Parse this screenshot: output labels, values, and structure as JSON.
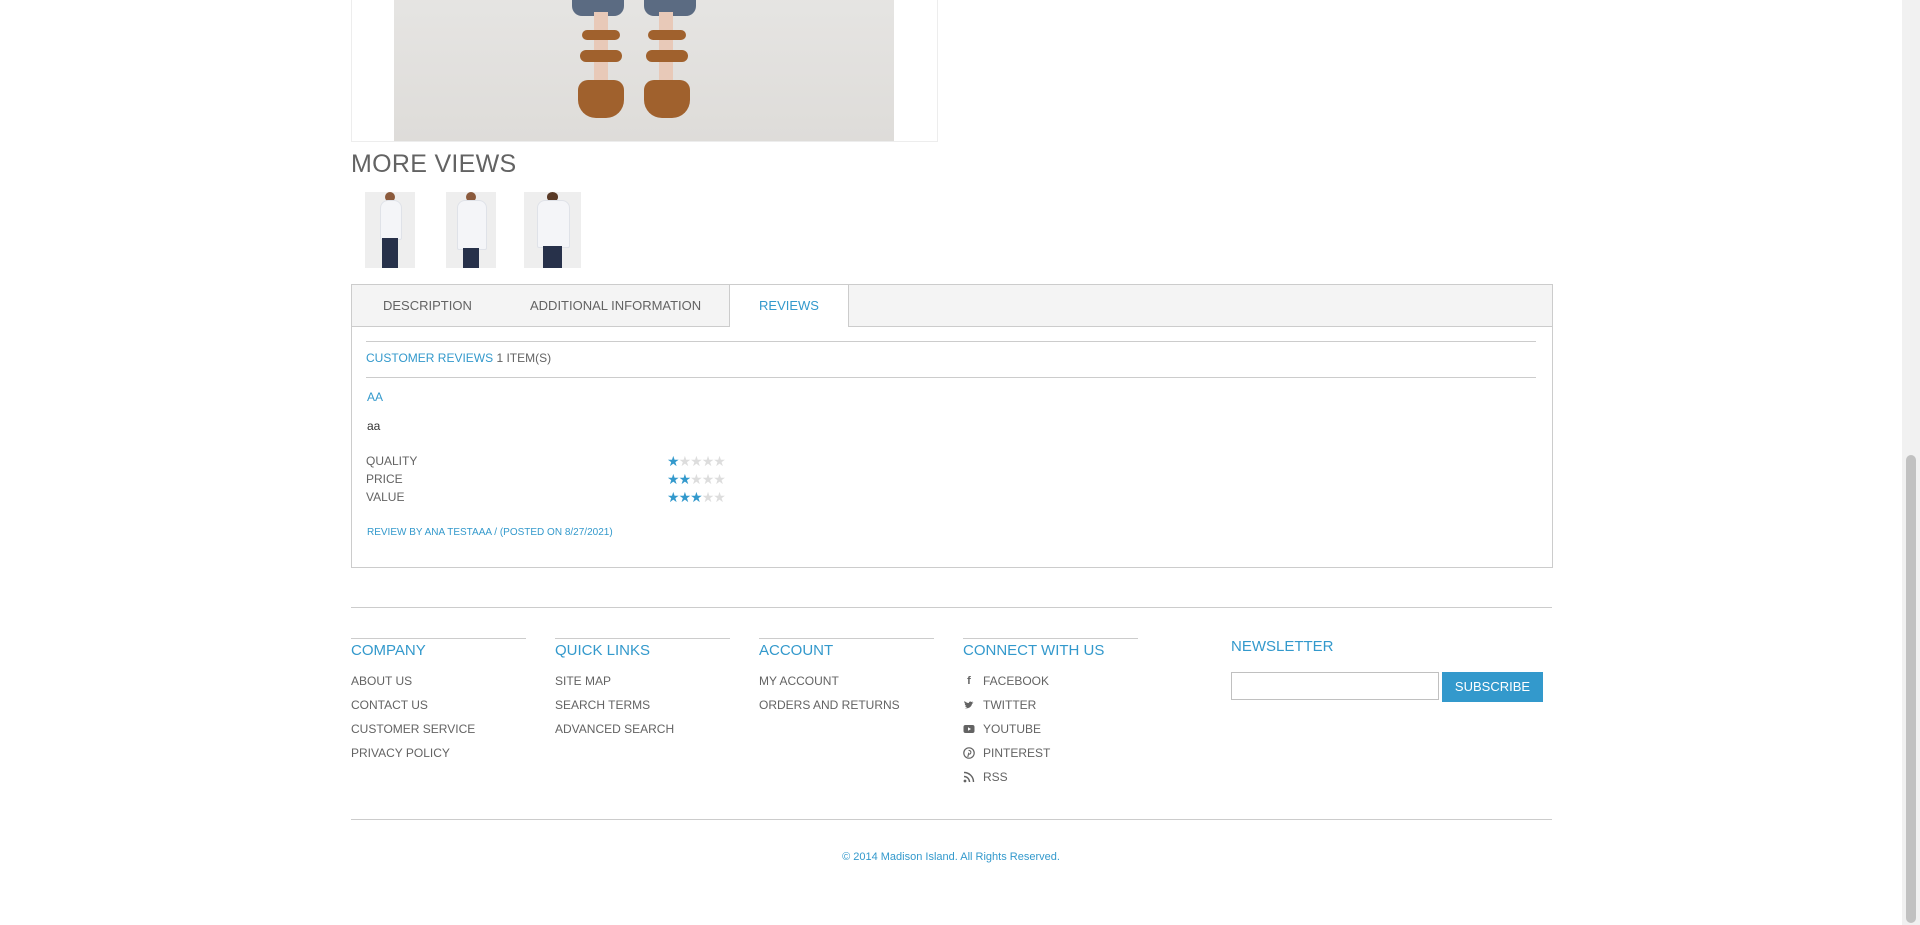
{
  "more_views": {
    "title": "MORE VIEWS",
    "thumbnails": [
      "product-view-front-full",
      "product-view-front-half",
      "product-view-back"
    ]
  },
  "tabs": [
    {
      "label": "DESCRIPTION",
      "active": false
    },
    {
      "label": "ADDITIONAL INFORMATION",
      "active": false
    },
    {
      "label": "REVIEWS",
      "active": true
    }
  ],
  "reviews": {
    "header_link": "CUSTOMER REVIEWS",
    "header_count": "1 ITEM(S)",
    "review_title": "AA",
    "review_text": "aa",
    "ratings": [
      {
        "label": "QUALITY",
        "stars": 1,
        "max": 5
      },
      {
        "label": "PRICE",
        "stars": 2,
        "max": 5
      },
      {
        "label": "VALUE",
        "stars": 3,
        "max": 5
      }
    ],
    "byline": "REVIEW BY ANA TESTAAA / (POSTED ON 8/27/2021)"
  },
  "footer": {
    "columns": [
      {
        "title": "COMPANY",
        "links": [
          "ABOUT US",
          "CONTACT US",
          "CUSTOMER SERVICE",
          "PRIVACY POLICY"
        ]
      },
      {
        "title": "QUICK LINKS",
        "links": [
          "SITE MAP",
          "SEARCH TERMS",
          "ADVANCED SEARCH"
        ]
      },
      {
        "title": "ACCOUNT",
        "links": [
          "MY ACCOUNT",
          "ORDERS AND RETURNS"
        ]
      },
      {
        "title": "CONNECT WITH US",
        "links": [
          "FACEBOOK",
          "TWITTER",
          "YOUTUBE",
          "PINTEREST",
          "RSS"
        ]
      }
    ],
    "social_icons": [
      "facebook-icon",
      "twitter-icon",
      "youtube-icon",
      "pinterest-icon",
      "rss-icon"
    ],
    "newsletter": {
      "title": "NEWSLETTER",
      "button": "SUBSCRIBE",
      "placeholder": ""
    },
    "copyright": "© 2014 Madison Island. All Rights Reserved."
  },
  "colors": {
    "accent": "#3399cc",
    "text": "#636363",
    "border": "#cccccc"
  }
}
